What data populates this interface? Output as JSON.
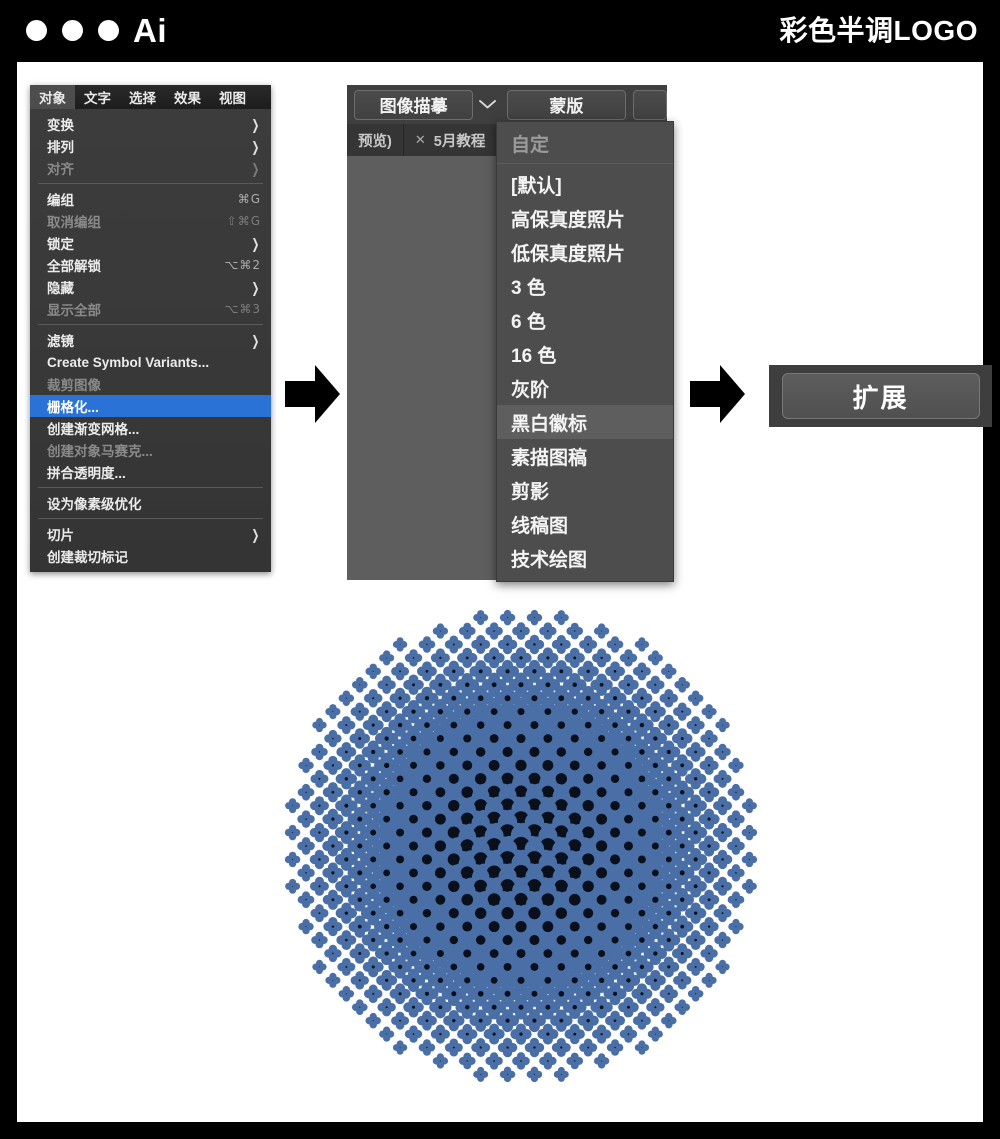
{
  "window": {
    "app_abbr": "Ai",
    "document_title": "彩色半调LOGO",
    "traffic_lights": [
      "close-dot",
      "minimize-dot",
      "zoom-dot"
    ]
  },
  "colors": {
    "titlebar_bg": "#000000",
    "canvas_bg": "#ffffff",
    "menu_bg": "#3a3a3a",
    "menu_highlight": "#2a72d6",
    "panel_bg": "#5e5e5e",
    "halftone_blue": "#4a6fa6",
    "halftone_core": "#080c18"
  },
  "object_menu": {
    "menubar": [
      {
        "label": "对象",
        "active": true
      },
      {
        "label": "文字",
        "active": false
      },
      {
        "label": "选择",
        "active": false
      },
      {
        "label": "效果",
        "active": false
      },
      {
        "label": "视图",
        "active": false
      }
    ],
    "groups": [
      {
        "items": [
          {
            "label": "变换",
            "shortcut": "",
            "submenu": true,
            "disabled": false,
            "selected": false
          },
          {
            "label": "排列",
            "shortcut": "",
            "submenu": true,
            "disabled": false,
            "selected": false
          },
          {
            "label": "对齐",
            "shortcut": "",
            "submenu": true,
            "disabled": true,
            "selected": false
          }
        ]
      },
      {
        "items": [
          {
            "label": "编组",
            "shortcut": "⌘G",
            "submenu": false,
            "disabled": false,
            "selected": false
          },
          {
            "label": "取消编组",
            "shortcut": "⇧⌘G",
            "submenu": false,
            "disabled": true,
            "selected": false
          },
          {
            "label": "锁定",
            "shortcut": "",
            "submenu": true,
            "disabled": false,
            "selected": false
          },
          {
            "label": "全部解锁",
            "shortcut": "⌥⌘2",
            "submenu": false,
            "disabled": false,
            "selected": false
          },
          {
            "label": "隐藏",
            "shortcut": "",
            "submenu": true,
            "disabled": false,
            "selected": false
          },
          {
            "label": "显示全部",
            "shortcut": "⌥⌘3",
            "submenu": false,
            "disabled": true,
            "selected": false
          }
        ]
      },
      {
        "items": [
          {
            "label": "滤镜",
            "shortcut": "",
            "submenu": true,
            "disabled": false,
            "selected": false
          },
          {
            "label": "Create Symbol Variants...",
            "shortcut": "",
            "submenu": false,
            "disabled": false,
            "selected": false
          },
          {
            "label": "裁剪图像",
            "shortcut": "",
            "submenu": false,
            "disabled": true,
            "selected": false
          },
          {
            "label": "栅格化...",
            "shortcut": "",
            "submenu": false,
            "disabled": false,
            "selected": true
          },
          {
            "label": "创建渐变网格...",
            "shortcut": "",
            "submenu": false,
            "disabled": false,
            "selected": false
          },
          {
            "label": "创建对象马赛克...",
            "shortcut": "",
            "submenu": false,
            "disabled": true,
            "selected": false
          },
          {
            "label": "拼合透明度...",
            "shortcut": "",
            "submenu": false,
            "disabled": false,
            "selected": false
          }
        ]
      },
      {
        "items": [
          {
            "label": "设为像素级优化",
            "shortcut": "",
            "submenu": false,
            "disabled": false,
            "selected": false
          }
        ]
      },
      {
        "items": [
          {
            "label": "切片",
            "shortcut": "",
            "submenu": true,
            "disabled": false,
            "selected": false
          },
          {
            "label": "创建裁切标记",
            "shortcut": "",
            "submenu": false,
            "disabled": false,
            "selected": false
          }
        ]
      }
    ]
  },
  "trace_panel": {
    "toolbar": {
      "image_trace_label": "图像描摹",
      "dropdown_caret": "chevron-down-icon",
      "mask_label": "蒙版",
      "third_button_label": ""
    },
    "tabs": [
      {
        "label": "预览)",
        "closable": false
      },
      {
        "label": "5月教程",
        "closable": true
      }
    ],
    "preset_dropdown": {
      "header": {
        "label": "自定",
        "disabled": true
      },
      "options": [
        {
          "label": "[默认]",
          "highlighted": false
        },
        {
          "label": "高保真度照片",
          "highlighted": false
        },
        {
          "label": "低保真度照片",
          "highlighted": false
        },
        {
          "label": "3 色",
          "highlighted": false
        },
        {
          "label": "6 色",
          "highlighted": false
        },
        {
          "label": "16 色",
          "highlighted": false
        },
        {
          "label": "灰阶",
          "highlighted": false
        },
        {
          "label": "黑白徽标",
          "highlighted": true
        },
        {
          "label": "素描图稿",
          "highlighted": false
        },
        {
          "label": "剪影",
          "highlighted": false
        },
        {
          "label": "线稿图",
          "highlighted": false
        },
        {
          "label": "技术绘图",
          "highlighted": false
        }
      ]
    }
  },
  "flow": {
    "arrow_1": "arrow-right-icon",
    "arrow_2": "arrow-right-icon"
  },
  "expand_panel": {
    "button_label": "扩展"
  },
  "artwork": {
    "name": "halftone-circle-logo",
    "description": "彩色半调 LOGO 圆形网点图",
    "grid_rotation_deg": 45,
    "dot_spacing": 19,
    "radius": 237,
    "blue": "#4a6fa6",
    "core": "#0a0f1c"
  }
}
